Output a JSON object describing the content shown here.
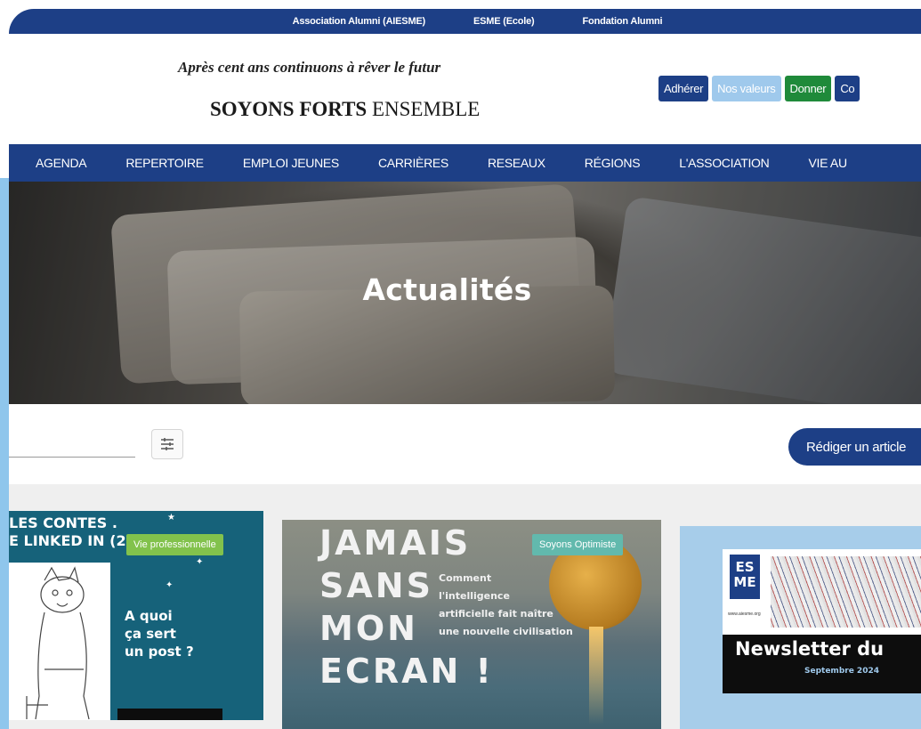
{
  "topbar": {
    "links": [
      "Association Alumni (AIESME)",
      "ESME (Ecole)",
      "Fondation Alumni"
    ]
  },
  "header": {
    "slogan": "Après cent ans continuons à rêver le futur",
    "brand_bold": "SOYONS FORTS",
    "brand_regular": "ENSEMBLE",
    "buttons": {
      "join": "Adhérer",
      "values": "Nos valeurs",
      "donate": "Donner",
      "connect": "Co"
    }
  },
  "nav": {
    "items": [
      "AGENDA",
      "REPERTOIRE",
      "EMPLOI JEUNES",
      "CARRIÈRES",
      "RESEAUX",
      "RÉGIONS",
      "L'ASSOCIATION",
      "VIE AU"
    ]
  },
  "hero": {
    "title": "Actualités"
  },
  "toolbar": {
    "search_value": "",
    "write_label": "Rédiger un article"
  },
  "cards": [
    {
      "tag": "Vie professionnelle",
      "headline_line1": "LES CONTES .",
      "headline_line2": "E LINKED IN (25)",
      "text_lines": [
        "A quoi",
        "ça sert",
        "un post ?"
      ]
    },
    {
      "tag": "Soyons Optimiste",
      "big_lines": [
        "JAMAIS",
        "SANS",
        "MON",
        "ECRAN !"
      ],
      "sub_lines": [
        "Comment",
        "l'intelligence",
        "artificielle fait naître",
        "une nouvelle civilisation"
      ]
    },
    {
      "logo_top": "ES",
      "logo_bottom": "ME",
      "url": "www.aiesme.org",
      "title": "Newsletter du",
      "date": "Septembre 2024"
    }
  ],
  "colors": {
    "primary": "#1d3f86",
    "light_blue": "#9fc9ec",
    "green": "#1f8a3a",
    "tag_green": "#82c24c",
    "tag_teal": "#62b9ad"
  },
  "icons": {
    "filter": "sliders-icon"
  }
}
